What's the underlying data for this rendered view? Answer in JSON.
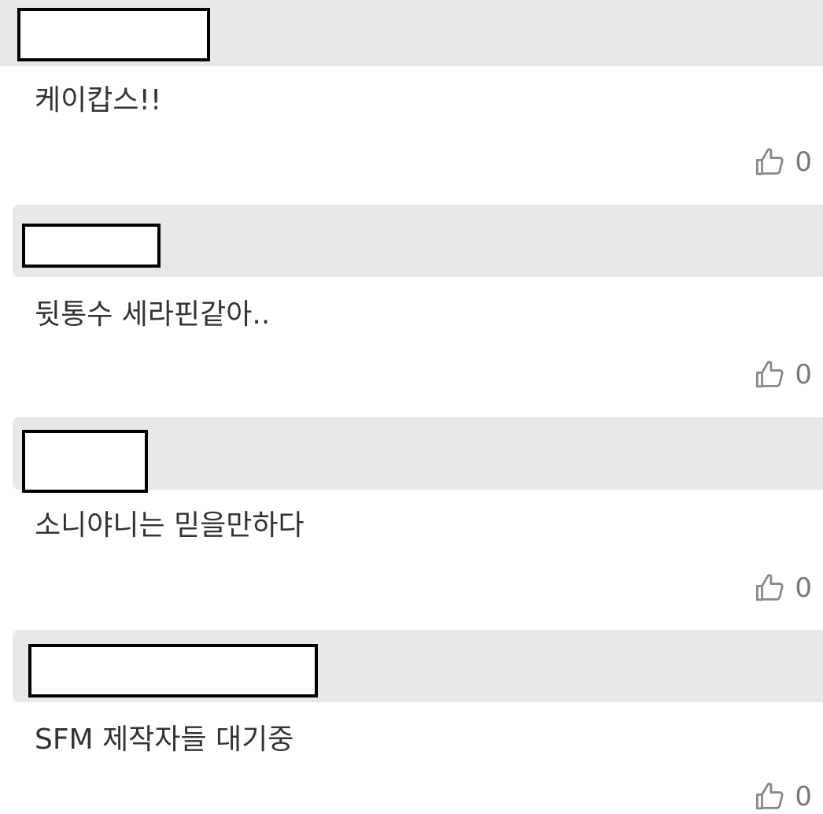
{
  "comments": [
    {
      "text": "케이캅스!!",
      "like_icon": "thumbs-up-icon",
      "like_count": "0"
    },
    {
      "text": "뒷통수 세라핀같아..",
      "like_icon": "thumbs-up-icon",
      "like_count": "0"
    },
    {
      "text": "소니야니는 믿을만하다",
      "like_icon": "thumbs-up-icon",
      "like_count": "0"
    },
    {
      "text": "SFM 제작자들 대기중",
      "like_icon": "thumbs-up-icon",
      "like_count": "0"
    }
  ],
  "colors": {
    "header_bg": "#e8e8e8",
    "text": "#333333",
    "like_count": "#777777",
    "redaction_border": "#000000"
  }
}
